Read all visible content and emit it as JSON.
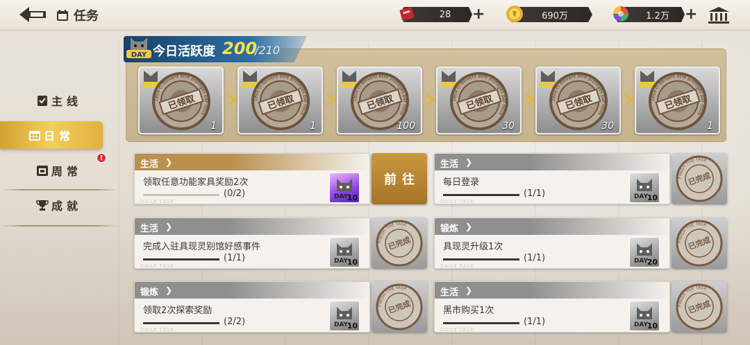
{
  "header": {
    "title": "任务",
    "resources": [
      {
        "icon": "ticket-icon",
        "value": "28",
        "has_plus": true
      },
      {
        "icon": "gold-coin-icon",
        "value": "690万",
        "has_plus": false
      },
      {
        "icon": "crystal-gem-icon",
        "value": "1.2万",
        "has_plus": true
      }
    ]
  },
  "nav": {
    "items": [
      {
        "label": "主线",
        "icon": "clipboard-check-icon",
        "active": false
      },
      {
        "label": "日常",
        "icon": "calendar-icon",
        "active": true
      },
      {
        "label": "周常",
        "icon": "weekly-calendar-icon",
        "active": false,
        "alert": "!"
      },
      {
        "label": "成就",
        "icon": "trophy-icon",
        "active": false
      }
    ]
  },
  "activity": {
    "label": "今日活跃度",
    "value": "200",
    "max": "/210",
    "badge_text": "DAY",
    "chests": [
      {
        "count": "1",
        "status": "已领取"
      },
      {
        "count": "1",
        "status": "已领取"
      },
      {
        "count": "100",
        "status": "已领取"
      },
      {
        "count": "30",
        "status": "已领取"
      },
      {
        "count": "30",
        "status": "已领取"
      },
      {
        "count": "1",
        "status": "已领取"
      }
    ]
  },
  "tasks": [
    {
      "category": "生活",
      "name": "领取任意功能家具奖励2次",
      "progress": "(0/2)",
      "progress_fraction": 0,
      "reward": "10",
      "reward_type": "epic",
      "action": "前往",
      "done": false
    },
    {
      "category": "生活",
      "name": "每日登录",
      "progress": "(1/1)",
      "progress_fraction": 1,
      "reward": "10",
      "reward_type": "normal",
      "action": "已完成",
      "done": true
    },
    {
      "category": "生活",
      "name": "完成入驻具现灵别馆好感事件",
      "progress": "(1/1)",
      "progress_fraction": 1,
      "reward": "10",
      "reward_type": "normal",
      "action": "已完成",
      "done": true
    },
    {
      "category": "锻炼",
      "name": "具现灵升级1次",
      "progress": "(1/1)",
      "progress_fraction": 1,
      "reward": "20",
      "reward_type": "normal",
      "action": "已完成",
      "done": true
    },
    {
      "category": "锻炼",
      "name": "领取2次探索奖励",
      "progress": "(2/2)",
      "progress_fraction": 1,
      "reward": "10",
      "reward_type": "normal",
      "action": "已完成",
      "done": true
    },
    {
      "category": "生活",
      "name": "黑市购买1次",
      "progress": "(1/1)",
      "progress_fraction": 1,
      "reward": "10",
      "reward_type": "normal",
      "action": "已完成",
      "done": true
    }
  ],
  "task_watermark": "DAILY TASK",
  "stamp_ring_text": "FINISH THE TASK",
  "chest_ring_text": "ceux-ci doivent être protégés par nous",
  "colors": {
    "accent_gold": "#e0b040",
    "active_header": "#b9904e",
    "done_header": "#8f8f8f",
    "banner_blue": "#1f5589",
    "stamp_brown": "#7a5a40"
  }
}
